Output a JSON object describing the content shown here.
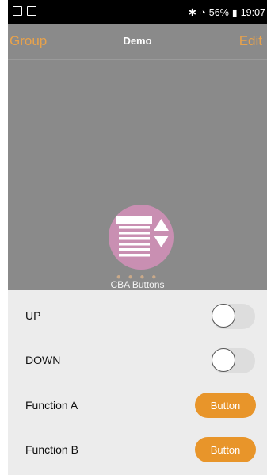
{
  "status_bar": {
    "battery": "56%",
    "time": "19:07"
  },
  "nav": {
    "left": "Group",
    "title": "Demo",
    "right": "Edit"
  },
  "device": {
    "icon": "blinds-updown-icon",
    "label": "CBA Buttons",
    "page_dots": "● ● ● ●",
    "colors": {
      "circle": "#c98fb2",
      "accent": "#e8a24b"
    }
  },
  "controls": [
    {
      "label": "UP",
      "type": "toggle",
      "on": false
    },
    {
      "label": "DOWN",
      "type": "toggle",
      "on": false
    },
    {
      "label": "Function A",
      "type": "button",
      "button_label": "Button"
    },
    {
      "label": "Function B",
      "type": "button",
      "button_label": "Button"
    }
  ]
}
